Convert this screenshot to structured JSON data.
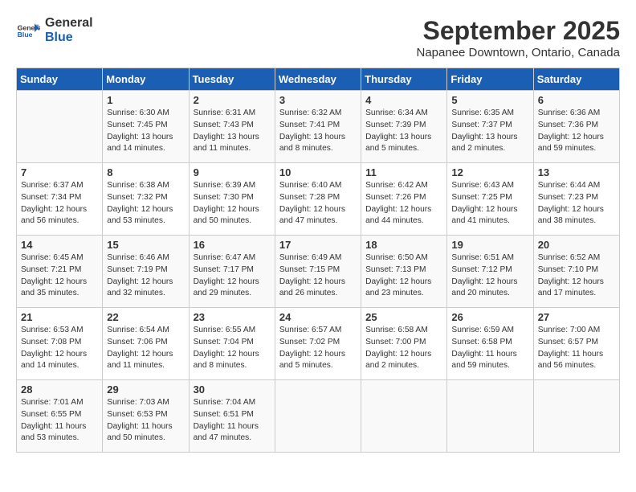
{
  "header": {
    "logo_general": "General",
    "logo_blue": "Blue",
    "title": "September 2025",
    "subtitle": "Napanee Downtown, Ontario, Canada"
  },
  "weekdays": [
    "Sunday",
    "Monday",
    "Tuesday",
    "Wednesday",
    "Thursday",
    "Friday",
    "Saturday"
  ],
  "weeks": [
    [
      {
        "day": "",
        "sunrise": "",
        "sunset": "",
        "daylight": ""
      },
      {
        "day": "1",
        "sunrise": "Sunrise: 6:30 AM",
        "sunset": "Sunset: 7:45 PM",
        "daylight": "Daylight: 13 hours and 14 minutes."
      },
      {
        "day": "2",
        "sunrise": "Sunrise: 6:31 AM",
        "sunset": "Sunset: 7:43 PM",
        "daylight": "Daylight: 13 hours and 11 minutes."
      },
      {
        "day": "3",
        "sunrise": "Sunrise: 6:32 AM",
        "sunset": "Sunset: 7:41 PM",
        "daylight": "Daylight: 13 hours and 8 minutes."
      },
      {
        "day": "4",
        "sunrise": "Sunrise: 6:34 AM",
        "sunset": "Sunset: 7:39 PM",
        "daylight": "Daylight: 13 hours and 5 minutes."
      },
      {
        "day": "5",
        "sunrise": "Sunrise: 6:35 AM",
        "sunset": "Sunset: 7:37 PM",
        "daylight": "Daylight: 13 hours and 2 minutes."
      },
      {
        "day": "6",
        "sunrise": "Sunrise: 6:36 AM",
        "sunset": "Sunset: 7:36 PM",
        "daylight": "Daylight: 12 hours and 59 minutes."
      }
    ],
    [
      {
        "day": "7",
        "sunrise": "Sunrise: 6:37 AM",
        "sunset": "Sunset: 7:34 PM",
        "daylight": "Daylight: 12 hours and 56 minutes."
      },
      {
        "day": "8",
        "sunrise": "Sunrise: 6:38 AM",
        "sunset": "Sunset: 7:32 PM",
        "daylight": "Daylight: 12 hours and 53 minutes."
      },
      {
        "day": "9",
        "sunrise": "Sunrise: 6:39 AM",
        "sunset": "Sunset: 7:30 PM",
        "daylight": "Daylight: 12 hours and 50 minutes."
      },
      {
        "day": "10",
        "sunrise": "Sunrise: 6:40 AM",
        "sunset": "Sunset: 7:28 PM",
        "daylight": "Daylight: 12 hours and 47 minutes."
      },
      {
        "day": "11",
        "sunrise": "Sunrise: 6:42 AM",
        "sunset": "Sunset: 7:26 PM",
        "daylight": "Daylight: 12 hours and 44 minutes."
      },
      {
        "day": "12",
        "sunrise": "Sunrise: 6:43 AM",
        "sunset": "Sunset: 7:25 PM",
        "daylight": "Daylight: 12 hours and 41 minutes."
      },
      {
        "day": "13",
        "sunrise": "Sunrise: 6:44 AM",
        "sunset": "Sunset: 7:23 PM",
        "daylight": "Daylight: 12 hours and 38 minutes."
      }
    ],
    [
      {
        "day": "14",
        "sunrise": "Sunrise: 6:45 AM",
        "sunset": "Sunset: 7:21 PM",
        "daylight": "Daylight: 12 hours and 35 minutes."
      },
      {
        "day": "15",
        "sunrise": "Sunrise: 6:46 AM",
        "sunset": "Sunset: 7:19 PM",
        "daylight": "Daylight: 12 hours and 32 minutes."
      },
      {
        "day": "16",
        "sunrise": "Sunrise: 6:47 AM",
        "sunset": "Sunset: 7:17 PM",
        "daylight": "Daylight: 12 hours and 29 minutes."
      },
      {
        "day": "17",
        "sunrise": "Sunrise: 6:49 AM",
        "sunset": "Sunset: 7:15 PM",
        "daylight": "Daylight: 12 hours and 26 minutes."
      },
      {
        "day": "18",
        "sunrise": "Sunrise: 6:50 AM",
        "sunset": "Sunset: 7:13 PM",
        "daylight": "Daylight: 12 hours and 23 minutes."
      },
      {
        "day": "19",
        "sunrise": "Sunrise: 6:51 AM",
        "sunset": "Sunset: 7:12 PM",
        "daylight": "Daylight: 12 hours and 20 minutes."
      },
      {
        "day": "20",
        "sunrise": "Sunrise: 6:52 AM",
        "sunset": "Sunset: 7:10 PM",
        "daylight": "Daylight: 12 hours and 17 minutes."
      }
    ],
    [
      {
        "day": "21",
        "sunrise": "Sunrise: 6:53 AM",
        "sunset": "Sunset: 7:08 PM",
        "daylight": "Daylight: 12 hours and 14 minutes."
      },
      {
        "day": "22",
        "sunrise": "Sunrise: 6:54 AM",
        "sunset": "Sunset: 7:06 PM",
        "daylight": "Daylight: 12 hours and 11 minutes."
      },
      {
        "day": "23",
        "sunrise": "Sunrise: 6:55 AM",
        "sunset": "Sunset: 7:04 PM",
        "daylight": "Daylight: 12 hours and 8 minutes."
      },
      {
        "day": "24",
        "sunrise": "Sunrise: 6:57 AM",
        "sunset": "Sunset: 7:02 PM",
        "daylight": "Daylight: 12 hours and 5 minutes."
      },
      {
        "day": "25",
        "sunrise": "Sunrise: 6:58 AM",
        "sunset": "Sunset: 7:00 PM",
        "daylight": "Daylight: 12 hours and 2 minutes."
      },
      {
        "day": "26",
        "sunrise": "Sunrise: 6:59 AM",
        "sunset": "Sunset: 6:58 PM",
        "daylight": "Daylight: 11 hours and 59 minutes."
      },
      {
        "day": "27",
        "sunrise": "Sunrise: 7:00 AM",
        "sunset": "Sunset: 6:57 PM",
        "daylight": "Daylight: 11 hours and 56 minutes."
      }
    ],
    [
      {
        "day": "28",
        "sunrise": "Sunrise: 7:01 AM",
        "sunset": "Sunset: 6:55 PM",
        "daylight": "Daylight: 11 hours and 53 minutes."
      },
      {
        "day": "29",
        "sunrise": "Sunrise: 7:03 AM",
        "sunset": "Sunset: 6:53 PM",
        "daylight": "Daylight: 11 hours and 50 minutes."
      },
      {
        "day": "30",
        "sunrise": "Sunrise: 7:04 AM",
        "sunset": "Sunset: 6:51 PM",
        "daylight": "Daylight: 11 hours and 47 minutes."
      },
      {
        "day": "",
        "sunrise": "",
        "sunset": "",
        "daylight": ""
      },
      {
        "day": "",
        "sunrise": "",
        "sunset": "",
        "daylight": ""
      },
      {
        "day": "",
        "sunrise": "",
        "sunset": "",
        "daylight": ""
      },
      {
        "day": "",
        "sunrise": "",
        "sunset": "",
        "daylight": ""
      }
    ]
  ]
}
